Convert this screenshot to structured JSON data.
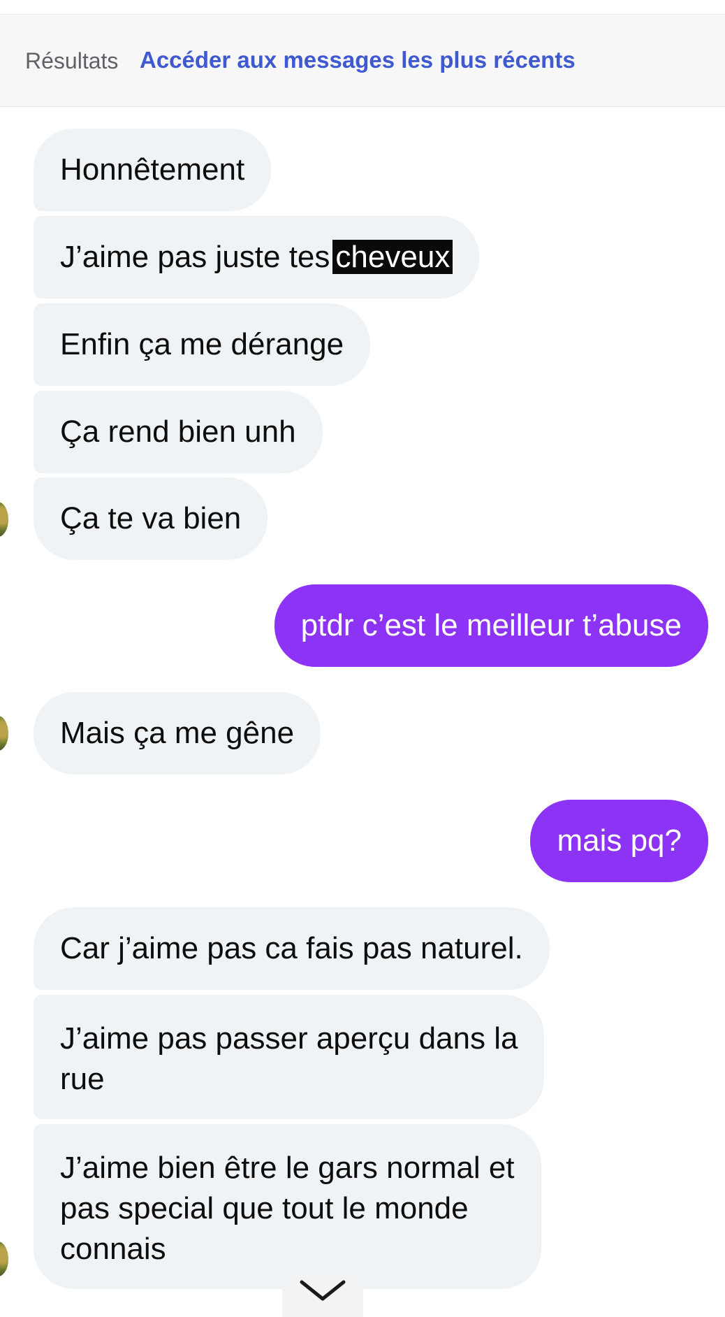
{
  "header": {
    "results_label": "Résultats",
    "jump_link": "Accéder aux messages les plus récents"
  },
  "messages": [
    {
      "from": "them",
      "text": "Honnêtement"
    },
    {
      "from": "them",
      "text_before": "J’aime pas juste tes",
      "highlight": "cheveux"
    },
    {
      "from": "them",
      "text": "Enfin ça me dérange"
    },
    {
      "from": "them",
      "text": "Ça rend bien unh"
    },
    {
      "from": "them",
      "text": "Ça te va bien"
    },
    {
      "from": "me",
      "text": "ptdr c’est le meilleur t’abuse"
    },
    {
      "from": "them",
      "text": "Mais ça me gêne"
    },
    {
      "from": "me",
      "text": "mais pq?"
    },
    {
      "from": "them",
      "text": "Car j’aime pas ca fais pas naturel."
    },
    {
      "from": "them",
      "lines": [
        "J’aime pas passer aperçu dans la",
        "rue"
      ]
    },
    {
      "from": "them",
      "lines": [
        "J’aime bien être le gars normal et",
        "pas special que tout le monde",
        "connais"
      ]
    }
  ],
  "colors": {
    "incoming_bubble": "#eff3f5",
    "outgoing_bubble": "#8c33f5",
    "link": "#3f5ad0",
    "highlight": "#0a0a0a"
  },
  "icons": {
    "scroll": "chevron-down-icon",
    "avatar": "avatar"
  }
}
